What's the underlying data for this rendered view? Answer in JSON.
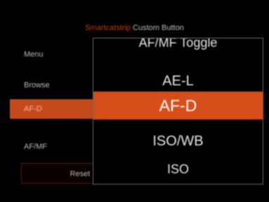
{
  "header": {
    "crumb": "Smartcatstrip",
    "page_title": "Custom Button"
  },
  "menu": {
    "items": [
      {
        "label": "Menu"
      },
      {
        "label": "Browse"
      },
      {
        "label": "AF-D",
        "selected": true
      },
      {
        "label": "AF/MF"
      }
    ],
    "reset_label": "Reset Custom buttons"
  },
  "popup": {
    "options": [
      {
        "label": "AF/MF Toggle"
      },
      {
        "label": "AE-L"
      },
      {
        "label": "AF-D",
        "selected": true
      },
      {
        "label": "ISO/WB"
      },
      {
        "label": "ISO"
      }
    ]
  },
  "colors": {
    "accent": "#d64e1a",
    "background": "#000000",
    "text": "#e6e6e6"
  }
}
